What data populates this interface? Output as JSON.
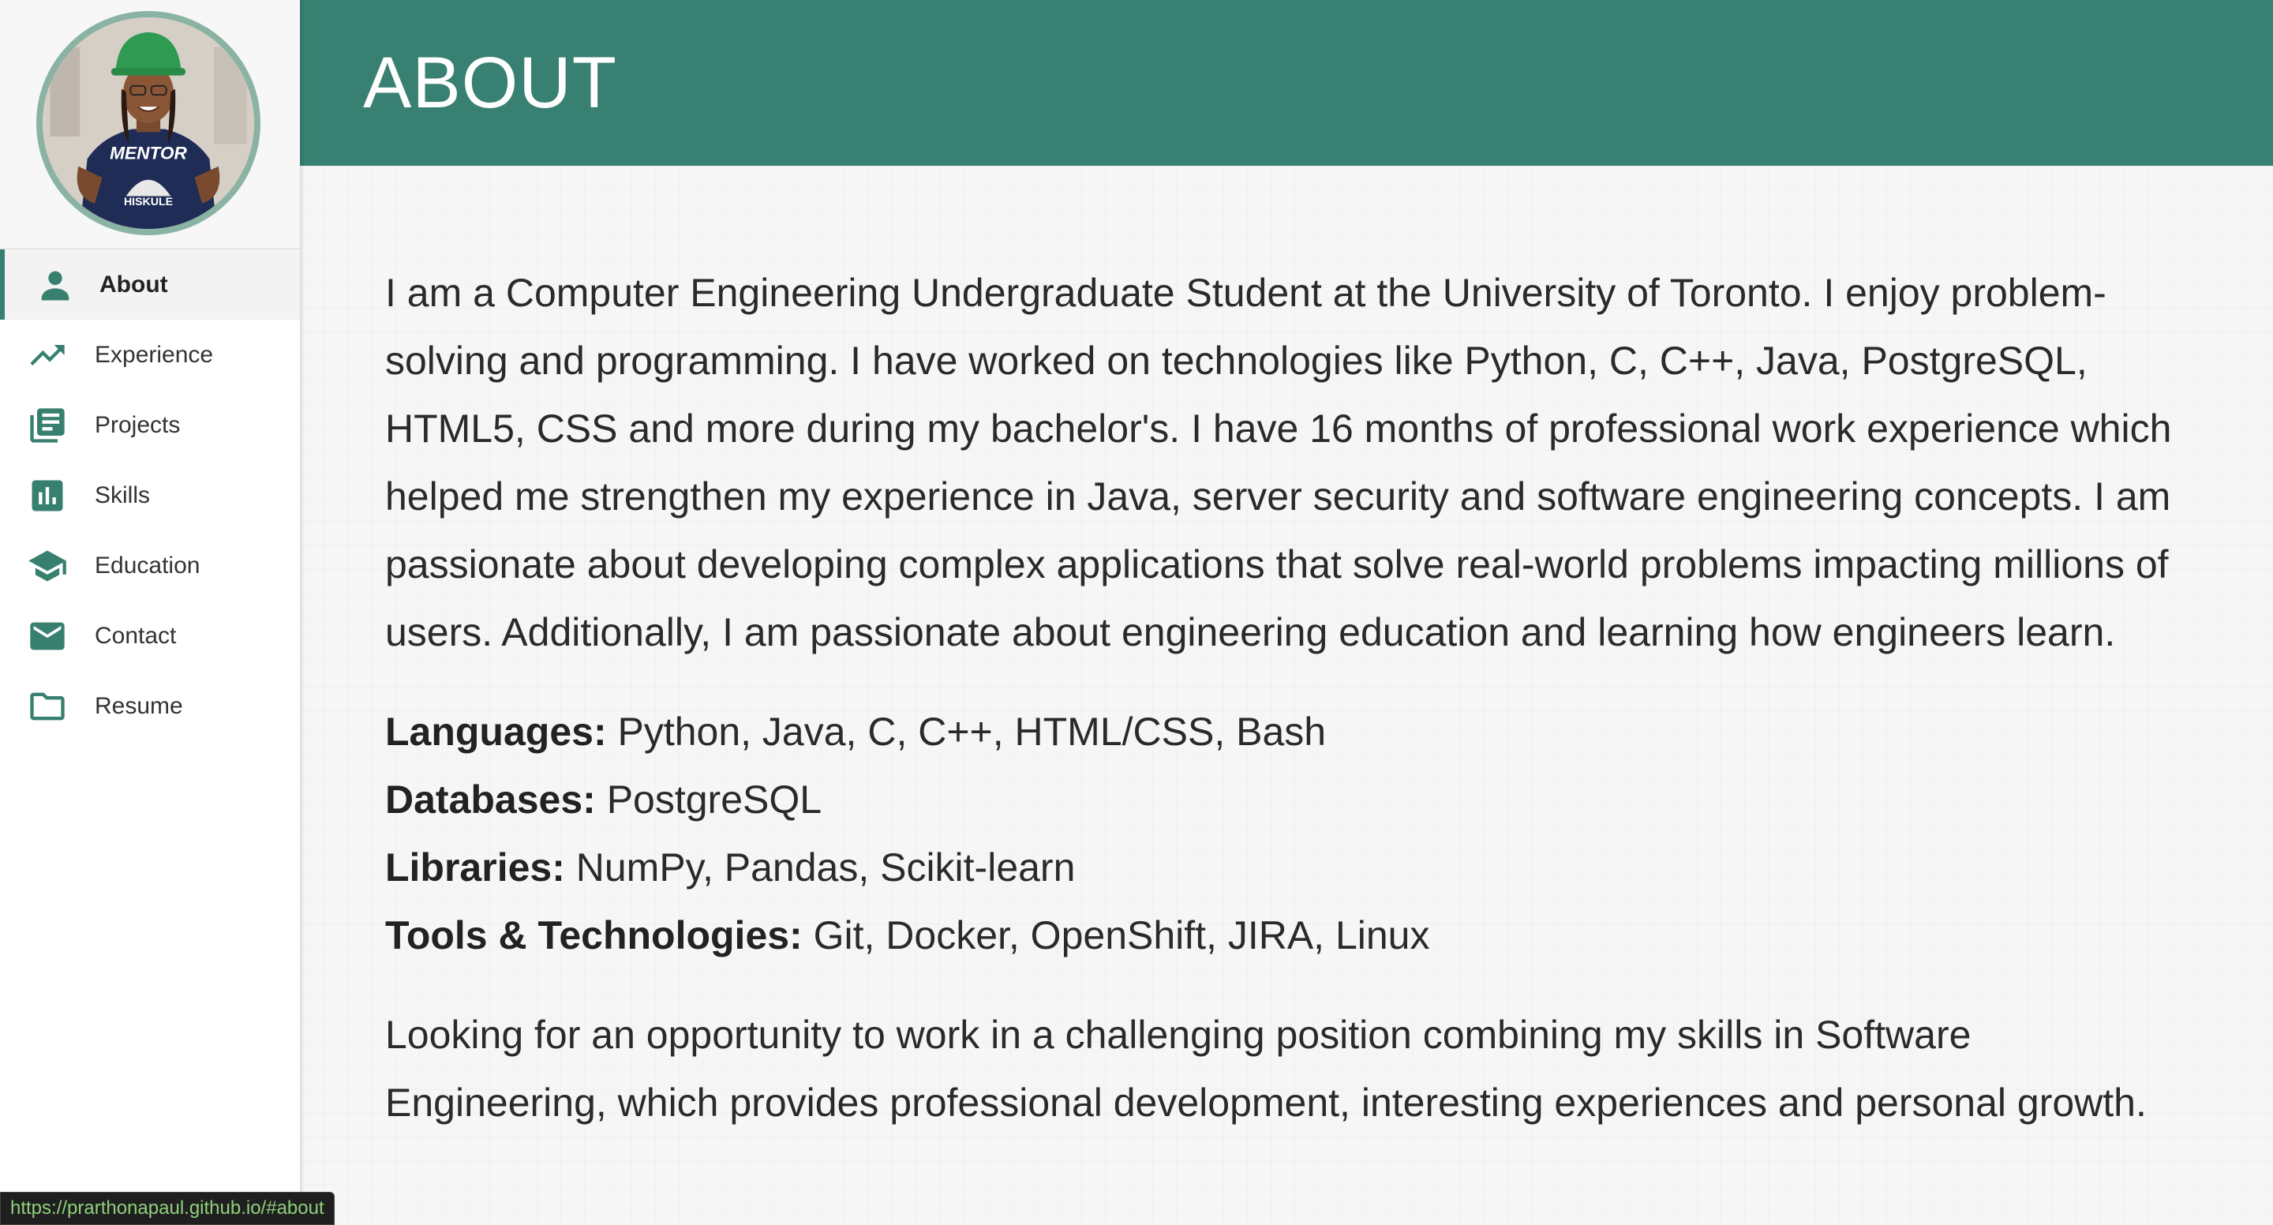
{
  "sidebar": {
    "avatar_shirt_text": "MENTOR",
    "avatar_logo_text": "HISKULE",
    "items": [
      {
        "label": "About",
        "icon": "person-icon",
        "active": true
      },
      {
        "label": "Experience",
        "icon": "trending-up-icon",
        "active": false
      },
      {
        "label": "Projects",
        "icon": "library-books-icon",
        "active": false
      },
      {
        "label": "Skills",
        "icon": "bar-chart-icon",
        "active": false
      },
      {
        "label": "Education",
        "icon": "school-icon",
        "active": false
      },
      {
        "label": "Contact",
        "icon": "mail-icon",
        "active": false
      },
      {
        "label": "Resume",
        "icon": "folder-icon",
        "active": false
      }
    ]
  },
  "header": {
    "title": "ABOUT"
  },
  "main": {
    "intro": "I am a Computer Engineering Undergraduate Student at the University of Toronto. I enjoy problem-solving and programming. I have worked on technologies like Python, C, C++, Java, PostgreSQL, HTML5, CSS and more during my bachelor's. I have 16 months of professional work experience which helped me strengthen my experience in Java, server security and software engineering concepts. I am passionate about developing complex applications that solve real-world problems impacting millions of users. Additionally, I am passionate about engineering education and learning how engineers learn.",
    "skills": [
      {
        "key": "Languages:",
        "value": " Python, Java, C, C++, HTML/CSS, Bash"
      },
      {
        "key": "Databases:",
        "value": " PostgreSQL"
      },
      {
        "key": "Libraries:",
        "value": " NumPy, Pandas, Scikit-learn"
      },
      {
        "key": "Tools & Technologies:",
        "value": " Git, Docker, OpenShift, JIRA, Linux"
      }
    ],
    "closing": "Looking for an opportunity to work in a challenging position combining my skills in Software Engineering, which provides professional development, interesting experiences and personal growth."
  },
  "statusbar": {
    "url": "https://prarthonapaul.github.io/#about"
  },
  "colors": {
    "accent": "#388071",
    "icon": "#37806f",
    "avatar_border": "#8ab3a4"
  }
}
